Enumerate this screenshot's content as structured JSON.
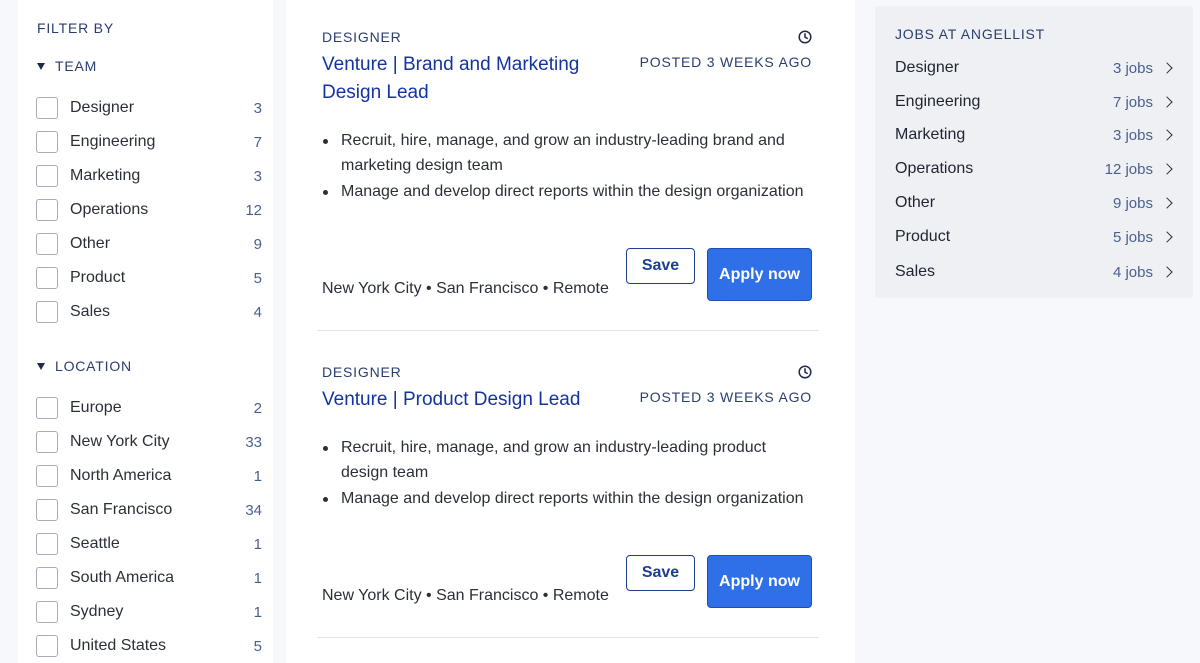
{
  "filters": {
    "heading": "FILTER BY",
    "team": {
      "title": "TEAM",
      "items": [
        {
          "label": "Designer",
          "count": "3"
        },
        {
          "label": "Engineering",
          "count": "7"
        },
        {
          "label": "Marketing",
          "count": "3"
        },
        {
          "label": "Operations",
          "count": "12"
        },
        {
          "label": "Other",
          "count": "9"
        },
        {
          "label": "Product",
          "count": "5"
        },
        {
          "label": "Sales",
          "count": "4"
        }
      ]
    },
    "location": {
      "title": "LOCATION",
      "items": [
        {
          "label": "Europe",
          "count": "2"
        },
        {
          "label": "New York City",
          "count": "33"
        },
        {
          "label": "North America",
          "count": "1"
        },
        {
          "label": "San Francisco",
          "count": "34"
        },
        {
          "label": "Seattle",
          "count": "1"
        },
        {
          "label": "South America",
          "count": "1"
        },
        {
          "label": "Sydney",
          "count": "1"
        },
        {
          "label": "United States",
          "count": "5"
        }
      ]
    }
  },
  "jobs": [
    {
      "category": "DESIGNER",
      "title": "Venture | Brand and Marketing Design Lead",
      "posted": "POSTED 3 WEEKS AGO",
      "bullets": [
        "Recruit, hire, manage, and grow an industry-leading brand and marketing design team",
        "Manage and develop direct reports within the design organization"
      ],
      "locations": "New York City • San Francisco • Remote",
      "save_label": "Save",
      "apply_label": "Apply now"
    },
    {
      "category": "DESIGNER",
      "title": "Venture | Product Design Lead",
      "posted": "POSTED 3 WEEKS AGO",
      "bullets": [
        "Recruit, hire, manage, and grow an industry-leading product design team",
        "Manage and develop direct reports within the design organization"
      ],
      "locations": "New York City • San Francisco • Remote",
      "save_label": "Save",
      "apply_label": "Apply now"
    }
  ],
  "sidebar": {
    "title": "JOBS AT ANGELLIST",
    "items": [
      {
        "name": "Designer",
        "count": "3 jobs"
      },
      {
        "name": "Engineering",
        "count": "7 jobs"
      },
      {
        "name": "Marketing",
        "count": "3 jobs"
      },
      {
        "name": "Operations",
        "count": "12 jobs"
      },
      {
        "name": "Other",
        "count": "9 jobs"
      },
      {
        "name": "Product",
        "count": "5 jobs"
      },
      {
        "name": "Sales",
        "count": "4 jobs"
      }
    ]
  },
  "icons": {
    "checkbox": "checkbox-icon",
    "caret": "caret-down-icon",
    "clock": "clock-icon",
    "chevron": "chevron-right-icon"
  },
  "colors": {
    "title_blue": "#1433a0",
    "apply_blue": "#2f6fe8",
    "muted_navy": "#2a3e6e"
  }
}
